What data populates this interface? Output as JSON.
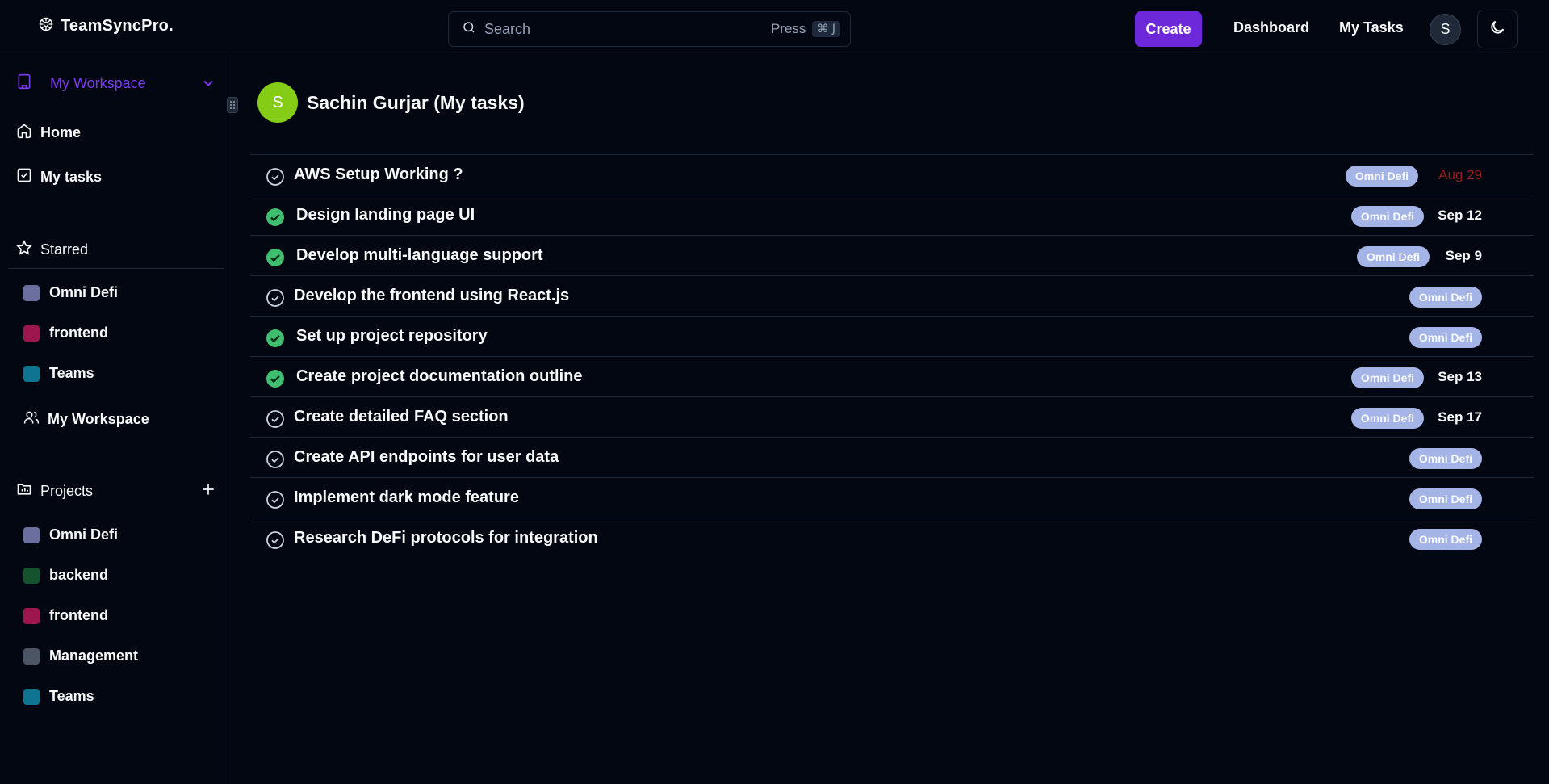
{
  "header": {
    "brand": "TeamSyncPro.",
    "search_placeholder": "Search",
    "press_label": "Press",
    "shortcut": "⌘ J",
    "create_label": "Create",
    "nav": [
      "Dashboard",
      "My Tasks"
    ],
    "avatar_initial": "S"
  },
  "sidebar": {
    "workspace_title": "My Workspace",
    "main_items": [
      "Home",
      "My tasks"
    ],
    "starred_title": "Starred",
    "starred": [
      {
        "label": "Omni Defi",
        "color": "#6b6fa0"
      },
      {
        "label": "frontend",
        "color": "#9d174d"
      },
      {
        "label": "Teams",
        "color": "#0e7490"
      }
    ],
    "my_workspace_label": "My Workspace",
    "projects_title": "Projects",
    "projects": [
      {
        "label": "Omni Defi",
        "color": "#6b6fa0"
      },
      {
        "label": "backend",
        "color": "#14532d"
      },
      {
        "label": "frontend",
        "color": "#9d174d"
      },
      {
        "label": "Management",
        "color": "#4b5563"
      },
      {
        "label": "Teams",
        "color": "#0e7490"
      }
    ]
  },
  "main": {
    "avatar_initial": "S",
    "title": "Sachin Gurjar (My tasks)",
    "tasks": [
      {
        "title": "AWS Setup Working ?",
        "done": false,
        "project": "Omni Defi",
        "due": "Aug 29",
        "overdue": true
      },
      {
        "title": "Design landing page UI",
        "done": true,
        "project": "Omni Defi",
        "due": "Sep 12",
        "overdue": false
      },
      {
        "title": "Develop multi-language support",
        "done": true,
        "project": "Omni Defi",
        "due": "Sep 9",
        "overdue": false
      },
      {
        "title": "Develop the frontend using React.js",
        "done": false,
        "project": "Omni Defi",
        "due": "",
        "overdue": false
      },
      {
        "title": "Set up project repository",
        "done": true,
        "project": "Omni Defi",
        "due": "",
        "overdue": false
      },
      {
        "title": "Create project documentation outline",
        "done": true,
        "project": "Omni Defi",
        "due": "Sep 13",
        "overdue": false
      },
      {
        "title": "Create detailed FAQ section",
        "done": false,
        "project": "Omni Defi",
        "due": "Sep 17",
        "overdue": false
      },
      {
        "title": "Create API endpoints for user data",
        "done": false,
        "project": "Omni Defi",
        "due": "",
        "overdue": false
      },
      {
        "title": "Implement dark mode feature",
        "done": false,
        "project": "Omni Defi",
        "due": "",
        "overdue": false
      },
      {
        "title": "Research DeFi protocols for integration",
        "done": false,
        "project": "Omni Defi",
        "due": "",
        "overdue": false
      }
    ]
  },
  "colors": {
    "accent": "#6d28d9",
    "workspace": "#7c3aed",
    "done_check": "#4ade80",
    "badge": "#a5b4e6",
    "overdue": "#991b1b",
    "avatar": "#84cc16"
  }
}
